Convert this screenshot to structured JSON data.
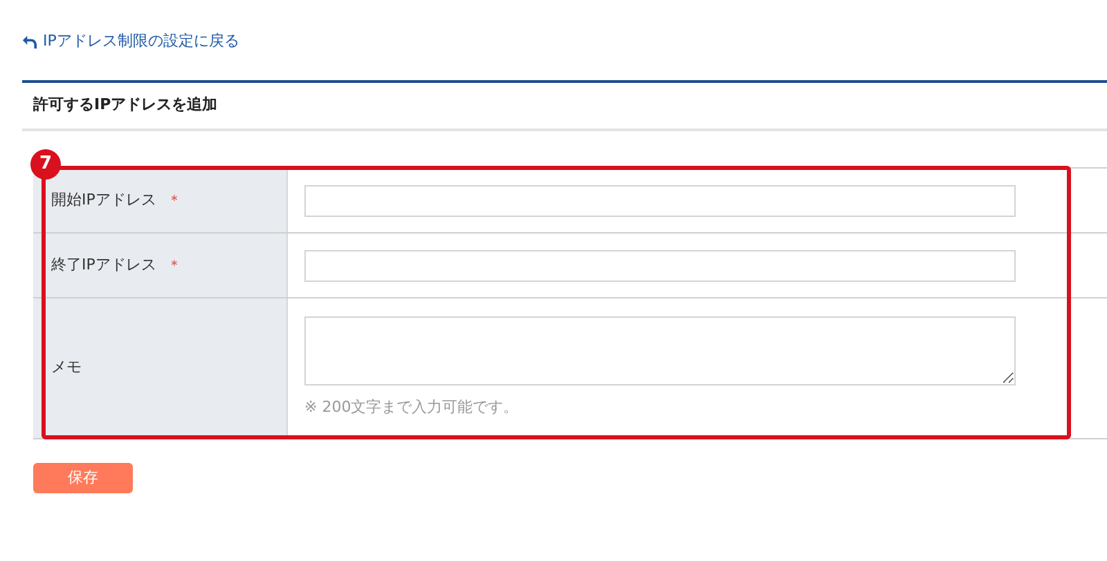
{
  "back_link": "IPアドレス制限の設定に戻る",
  "section_title": "許可するIPアドレスを追加",
  "annotation": {
    "number": "7"
  },
  "rows": [
    {
      "label": "開始IPアドレス",
      "required": true,
      "kind": "input"
    },
    {
      "label": "終了IPアドレス",
      "required": true,
      "kind": "input"
    },
    {
      "label": "メモ",
      "required": false,
      "kind": "textarea",
      "note": "※ 200文字まで入力可能です。"
    }
  ],
  "required_mark": "＊",
  "save_button": "保存"
}
